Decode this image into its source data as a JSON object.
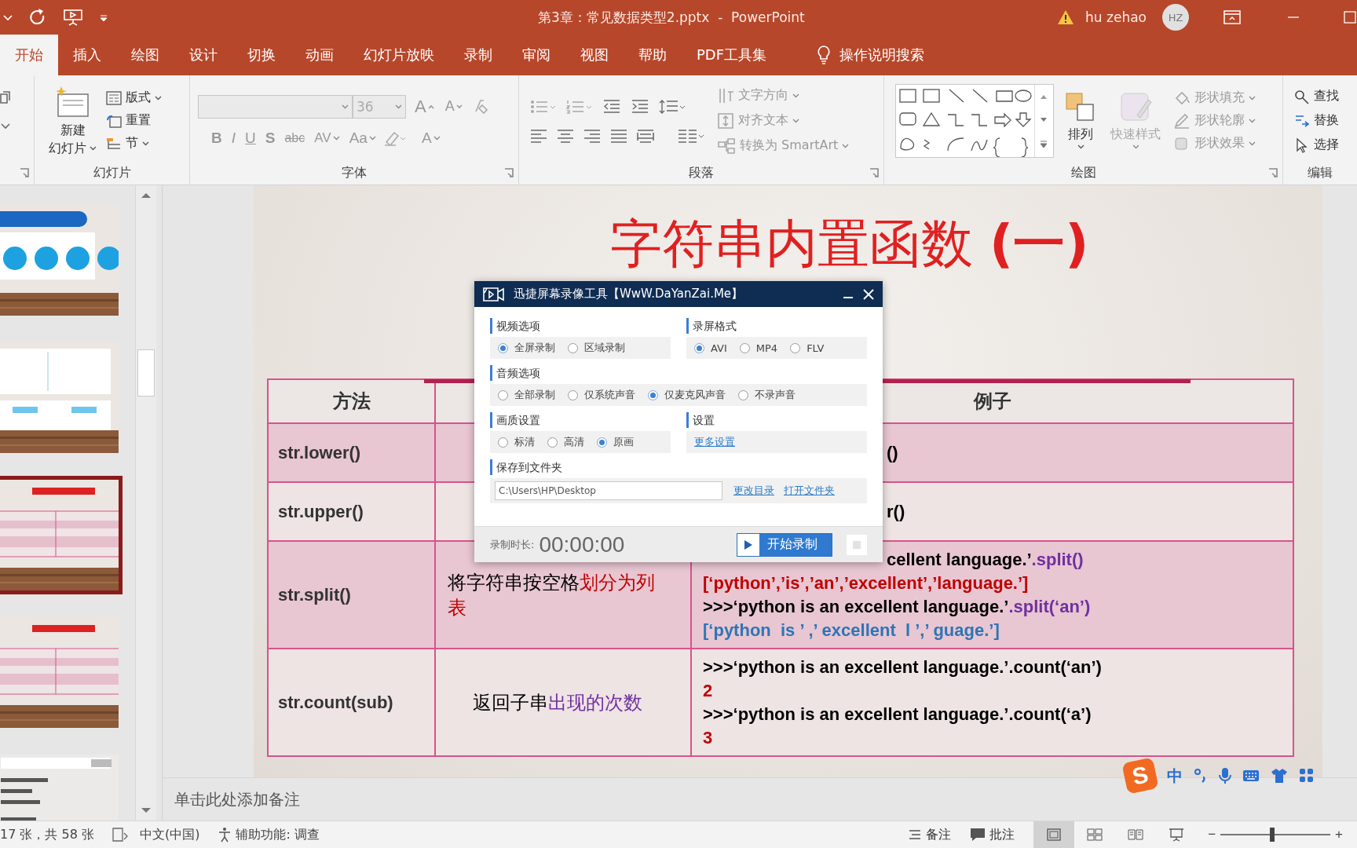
{
  "window": {
    "title": "第3章：常见数据类型2.pptx  -  PowerPoint",
    "user": "hu zehao",
    "avatar": "HZ"
  },
  "tabs": [
    {
      "label": "开始",
      "selected": true
    },
    {
      "label": "插入",
      "selected": false
    },
    {
      "label": "绘图",
      "selected": false
    },
    {
      "label": "设计",
      "selected": false
    },
    {
      "label": "切换",
      "selected": false
    },
    {
      "label": "动画",
      "selected": false
    },
    {
      "label": "幻灯片放映",
      "selected": false
    },
    {
      "label": "录制",
      "selected": false
    },
    {
      "label": "审阅",
      "selected": false
    },
    {
      "label": "视图",
      "selected": false
    },
    {
      "label": "帮助",
      "selected": false
    },
    {
      "label": "PDF工具集",
      "selected": false
    }
  ],
  "tell_me": "操作说明搜索",
  "ribbon": {
    "slides": {
      "label": "幻灯片",
      "new_slide": [
        "新建",
        "幻灯片"
      ],
      "buttons": [
        "版式",
        "重置",
        "节"
      ]
    },
    "font": {
      "label": "字体",
      "font_size": "36",
      "size_buttons": [
        "A",
        "A"
      ],
      "format_buttons": [
        "B",
        "I",
        "U",
        "S",
        "abc",
        "AV",
        "Aa"
      ],
      "color_button": "A"
    },
    "paragraph": {
      "label": "段落",
      "buttons": [
        "文字方向",
        "对齐文本",
        "转换为 SmartArt"
      ]
    },
    "drawing": {
      "label": "绘图",
      "arrange": "排列",
      "quick_styles": "快速样式",
      "buttons": [
        "形状填充",
        "形状轮廓",
        "形状效果"
      ]
    },
    "editing": {
      "label": "编辑",
      "buttons": [
        "查找",
        "替换",
        "选择"
      ]
    }
  },
  "thumbnails": [
    {
      "selected": false
    },
    {
      "selected": false
    },
    {
      "selected": true
    },
    {
      "selected": false
    },
    {
      "selected": false
    }
  ],
  "slide": {
    "title": "字符串内置函数 **(一)**",
    "table": {
      "columns": [
        "方法",
        "例子"
      ],
      "rows": [
        {
          "method": "str.lower()",
          "example": [
            {
              "covered": true,
              "segments": [
                {
                  "text": "()",
                  "color": "#000000"
                }
              ]
            }
          ]
        },
        {
          "method": "str.upper()",
          "example": [
            {
              "covered": true,
              "segments": [
                {
                  "text": "r()",
                  "color": "#000000"
                }
              ]
            }
          ]
        },
        {
          "method": "str.split()",
          "description": [
            {
              "text": "将字符串按空格",
              "color": "#000000"
            },
            {
              "text": "划分为列表",
              "color": "#c00000"
            }
          ],
          "example": [
            {
              "covered": true,
              "segments": [
                {
                  "text": "cellent language.’",
                  "color": "#000000"
                },
                {
                  "text": ".split()",
                  "color": "#7030a0"
                }
              ]
            },
            {
              "segments": [
                {
                  "text": "[‘python’,’is’,’an’,’excellent’,’language.’]",
                  "color": "#c00000"
                }
              ]
            },
            {
              "segments": [
                {
                  "text": ">>>‘python is an excellent language.’",
                  "color": "#000000"
                },
                {
                  "text": ".split(‘an’)",
                  "color": "#7030a0"
                }
              ]
            },
            {
              "segments": [
                {
                  "text": "[‘python  is ’ ,’ excellent  l ’,’ guage.’]",
                  "color": "#2e75b6"
                }
              ]
            }
          ]
        },
        {
          "method": "str.count(sub)",
          "description": [
            {
              "text": "返回子串",
              "color": "#000000"
            },
            {
              "text": "出现的次数",
              "color": "#7030a0"
            }
          ],
          "example": [
            {
              "segments": [
                {
                  "text": ">>>‘python is an excellent language.’.count(‘an’)",
                  "color": "#000000"
                }
              ]
            },
            {
              "segments": [
                {
                  "text": "2",
                  "color": "#c00000"
                }
              ]
            },
            {
              "segments": [
                {
                  "text": ">>>‘python is an excellent language.’.count(‘a’)",
                  "color": "#000000"
                }
              ]
            },
            {
              "segments": [
                {
                  "text": "3",
                  "color": "#c00000"
                }
              ]
            }
          ]
        }
      ]
    }
  },
  "dialog": {
    "title": "迅捷屏幕录像工具【WwW.DaYanZai.Me】",
    "rows": [
      [
        {
          "title": "视频选项",
          "kind": "radio",
          "options": [
            {
              "label": "全屏录制",
              "selected": true
            },
            {
              "label": "区域录制",
              "selected": false
            }
          ]
        },
        {
          "title": "录屏格式",
          "kind": "radio",
          "options": [
            {
              "label": "AVI",
              "selected": true
            },
            {
              "label": "MP4",
              "selected": false
            },
            {
              "label": "FLV",
              "selected": false
            }
          ]
        }
      ],
      [
        {
          "title": "音频选项",
          "kind": "radio",
          "options": [
            {
              "label": "全部录制",
              "selected": false
            },
            {
              "label": "仅系统声音",
              "selected": false
            },
            {
              "label": "仅麦克风声音",
              "selected": true
            },
            {
              "label": "不录声音",
              "selected": false
            }
          ]
        }
      ],
      [
        {
          "title": "画质设置",
          "kind": "radio",
          "options": [
            {
              "label": "标清",
              "selected": false
            },
            {
              "label": "高清",
              "selected": false
            },
            {
              "label": "原画",
              "selected": true
            }
          ]
        },
        {
          "title": "设置",
          "kind": "link",
          "links": [
            "更多设置"
          ]
        }
      ],
      [
        {
          "title": "保存到文件夹",
          "kind": "folder",
          "value": "C:\\Users\\HP\\Desktop",
          "links": [
            "更改目录",
            "打开文件夹"
          ]
        }
      ]
    ],
    "duration_label": "录制时长:",
    "duration": "00:00:00",
    "start_button": "开始录制"
  },
  "notes": {
    "placeholder": "单击此处添加备注"
  },
  "ime": {
    "logo": "S",
    "mode": "中"
  },
  "status_bar": {
    "slide_counter": "17 张，共 58 张",
    "language": "中文(中国)",
    "accessibility": "辅助功能: 调查",
    "notes_button": "备注",
    "comments_button": "批注",
    "view_buttons": [
      {
        "selected": true
      },
      {
        "selected": false
      },
      {
        "selected": false
      },
      {
        "selected": false
      }
    ],
    "zoom": {
      "minus": "−",
      "plus": "+",
      "level": 0.47
    }
  }
}
